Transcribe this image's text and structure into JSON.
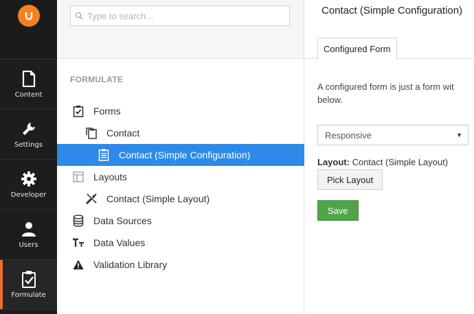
{
  "nav": {
    "items": [
      {
        "label": "Content",
        "icon": "document-icon"
      },
      {
        "label": "Settings",
        "icon": "wrench-icon"
      },
      {
        "label": "Developer",
        "icon": "gear-icon"
      },
      {
        "label": "Users",
        "icon": "user-icon"
      },
      {
        "label": "Formulate",
        "icon": "clipboard-check-icon"
      }
    ],
    "active": "Formulate",
    "logo_color": "#f5821f"
  },
  "search": {
    "placeholder": "Type to search..."
  },
  "tree": {
    "section_title": "FORMULATE",
    "items": [
      {
        "label": "Forms",
        "icon": "clipboard-check-icon",
        "level": 1
      },
      {
        "label": "Contact",
        "icon": "clipboard-copy-icon",
        "level": 2
      },
      {
        "label": "Contact (Simple Configuration)",
        "icon": "form-list-icon",
        "level": 3,
        "selected": true
      },
      {
        "label": "Layouts",
        "icon": "layout-icon",
        "level": 1
      },
      {
        "label": "Contact (Simple Layout)",
        "icon": "pencil-ruler-icon",
        "level": 2
      },
      {
        "label": "Data Sources",
        "icon": "database-icon",
        "level": 1
      },
      {
        "label": "Data Values",
        "icon": "text-size-icon",
        "level": 1
      },
      {
        "label": "Validation Library",
        "icon": "warning-icon",
        "level": 1
      }
    ]
  },
  "main": {
    "title": "Contact (Simple Configuration)",
    "tab_label": "Configured Form",
    "description_line1": "A configured form is just a form wit",
    "description_line2": "below.",
    "template_select": "Responsive",
    "layout_label": "Layout:",
    "layout_value": "Contact (Simple Layout)",
    "pick_layout_button": "Pick Layout",
    "save_button": "Save"
  },
  "colors": {
    "nav_bg": "#1d1d1d",
    "selected_bg": "#2d8ae8",
    "save_green": "#50a548",
    "active_accent": "#e86f2a"
  }
}
